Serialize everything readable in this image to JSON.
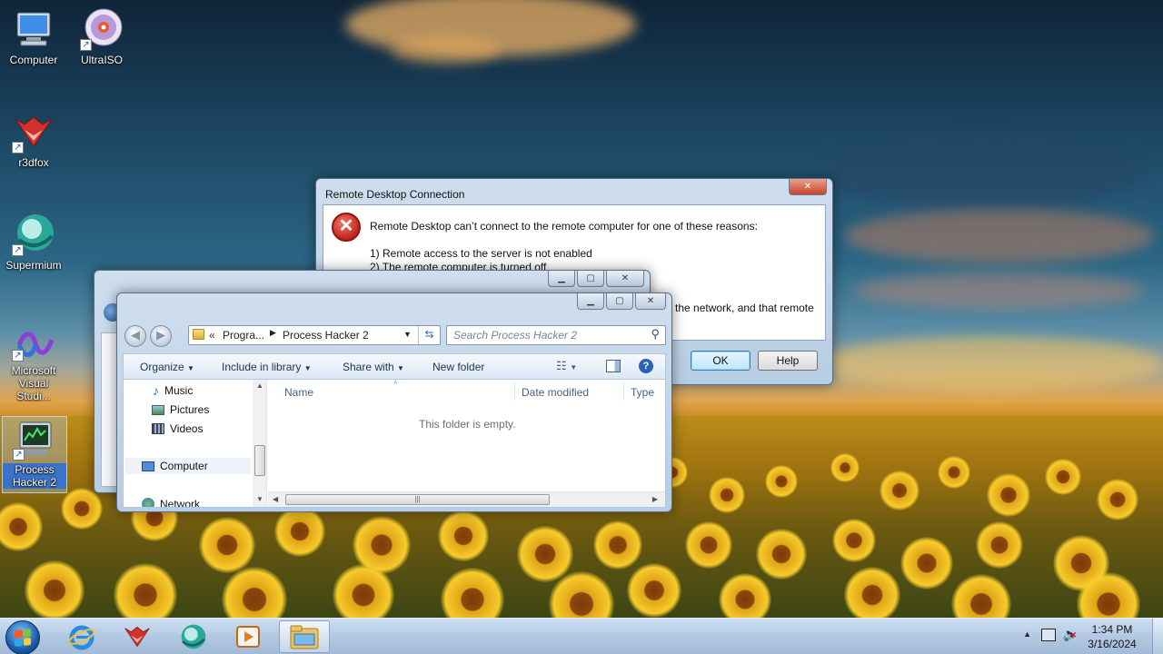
{
  "desktop": {
    "icons": [
      {
        "label": "Computer"
      },
      {
        "label": "UltraISO"
      },
      {
        "label": "r3dfox"
      },
      {
        "label": "Supermium"
      },
      {
        "label": "Microsoft Visual Studi..."
      },
      {
        "label": "Process Hacker 2"
      }
    ]
  },
  "rdc_dialog": {
    "title": "Remote Desktop Connection",
    "message": "Remote Desktop can’t connect to the remote computer for one of these reasons:",
    "reasons": [
      "1) Remote access to the server is not enabled",
      "2) The remote computer is turned off"
    ],
    "partial_text": "the network, and that remote",
    "ok_label": "OK",
    "help_label": "Help",
    "close_label": "✕"
  },
  "explorer": {
    "address": {
      "overflow": "«",
      "crumb1": "Progra...",
      "crumb2": "Process Hacker 2"
    },
    "search_placeholder": "Search Process Hacker 2",
    "commands": {
      "organize": "Organize",
      "include": "Include in library",
      "share": "Share with",
      "new_folder": "New folder"
    },
    "nav_items": [
      "Music",
      "Pictures",
      "Videos",
      "Computer",
      "Network"
    ],
    "columns": [
      "Name",
      "Date modified",
      "Type"
    ],
    "empty_text": "This folder is empty."
  },
  "taskbar": {
    "apps": [
      "internet-explorer-icon",
      "r3dfox-icon",
      "supermium-icon",
      "media-player-icon",
      "explorer-icon"
    ],
    "time": "1:34 PM",
    "date": "3/16/2024"
  }
}
